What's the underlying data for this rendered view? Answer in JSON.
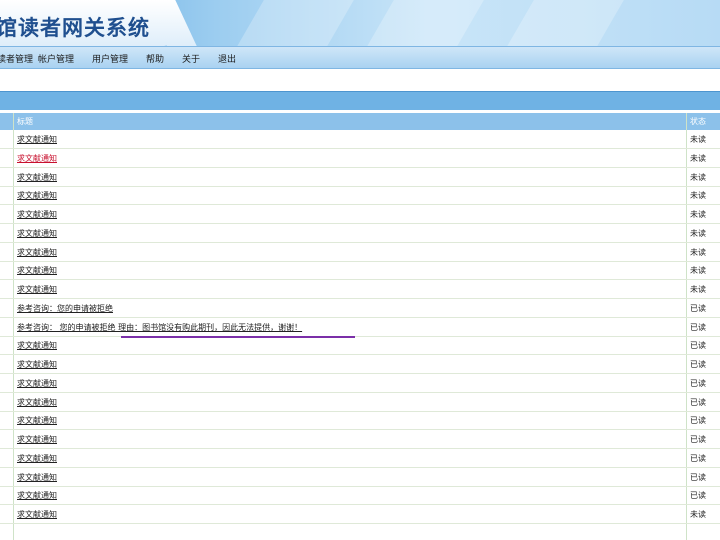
{
  "app": {
    "title": "馆读者网关系统"
  },
  "menu": [
    {
      "label": "读者管理"
    },
    {
      "label": "帐户管理"
    },
    {
      "label": "用户管理"
    },
    {
      "label": "帮助"
    },
    {
      "label": "关于"
    },
    {
      "label": "退出"
    }
  ],
  "table": {
    "headers": {
      "subject": "标题",
      "status": "状态"
    },
    "rows": [
      {
        "subject": "求文献通知",
        "status": "未读",
        "highlight": false
      },
      {
        "subject": "求文献通知",
        "status": "未读",
        "highlight": true
      },
      {
        "subject": "求文献通知",
        "status": "未读",
        "highlight": false
      },
      {
        "subject": "求文献通知",
        "status": "未读",
        "highlight": false
      },
      {
        "subject": "求文献通知",
        "status": "未读",
        "highlight": false
      },
      {
        "subject": "求文献通知",
        "status": "未读",
        "highlight": false
      },
      {
        "subject": "求文献通知",
        "status": "未读",
        "highlight": false
      },
      {
        "subject": "求文献通知",
        "status": "未读",
        "highlight": false
      },
      {
        "subject": "求文献通知",
        "status": "未读",
        "highlight": false
      },
      {
        "subject": "参考咨询：您的申请被拒绝",
        "status": "已读",
        "highlight": false
      },
      {
        "subject": "参考咨询：  您的申请被拒绝 理由：图书馆没有购此期刊，因此无法提供，谢谢！",
        "status": "已读",
        "highlight": false
      },
      {
        "subject": "求文献通知",
        "status": "已读",
        "highlight": false
      },
      {
        "subject": "求文献通知",
        "status": "已读",
        "highlight": false
      },
      {
        "subject": "求文献通知",
        "status": "已读",
        "highlight": false
      },
      {
        "subject": "求文献通知",
        "status": "已读",
        "highlight": false
      },
      {
        "subject": "求文献通知",
        "status": "已读",
        "highlight": false
      },
      {
        "subject": "求文献通知",
        "status": "已读",
        "highlight": false
      },
      {
        "subject": "求文献通知",
        "status": "已读",
        "highlight": false
      },
      {
        "subject": "求文献通知",
        "status": "已读",
        "highlight": false
      },
      {
        "subject": "求文献通知",
        "status": "已读",
        "highlight": false
      },
      {
        "subject": "求文献通知",
        "status": "未读",
        "highlight": false
      }
    ]
  },
  "colors": {
    "header_accent": "#5aa6dc",
    "menubar": "#a9d2f1",
    "band": "#6fb2e4",
    "table_header": "#8cc1ea",
    "highlight_text": "#c8102e",
    "annotation_line": "#7b2fa8"
  }
}
